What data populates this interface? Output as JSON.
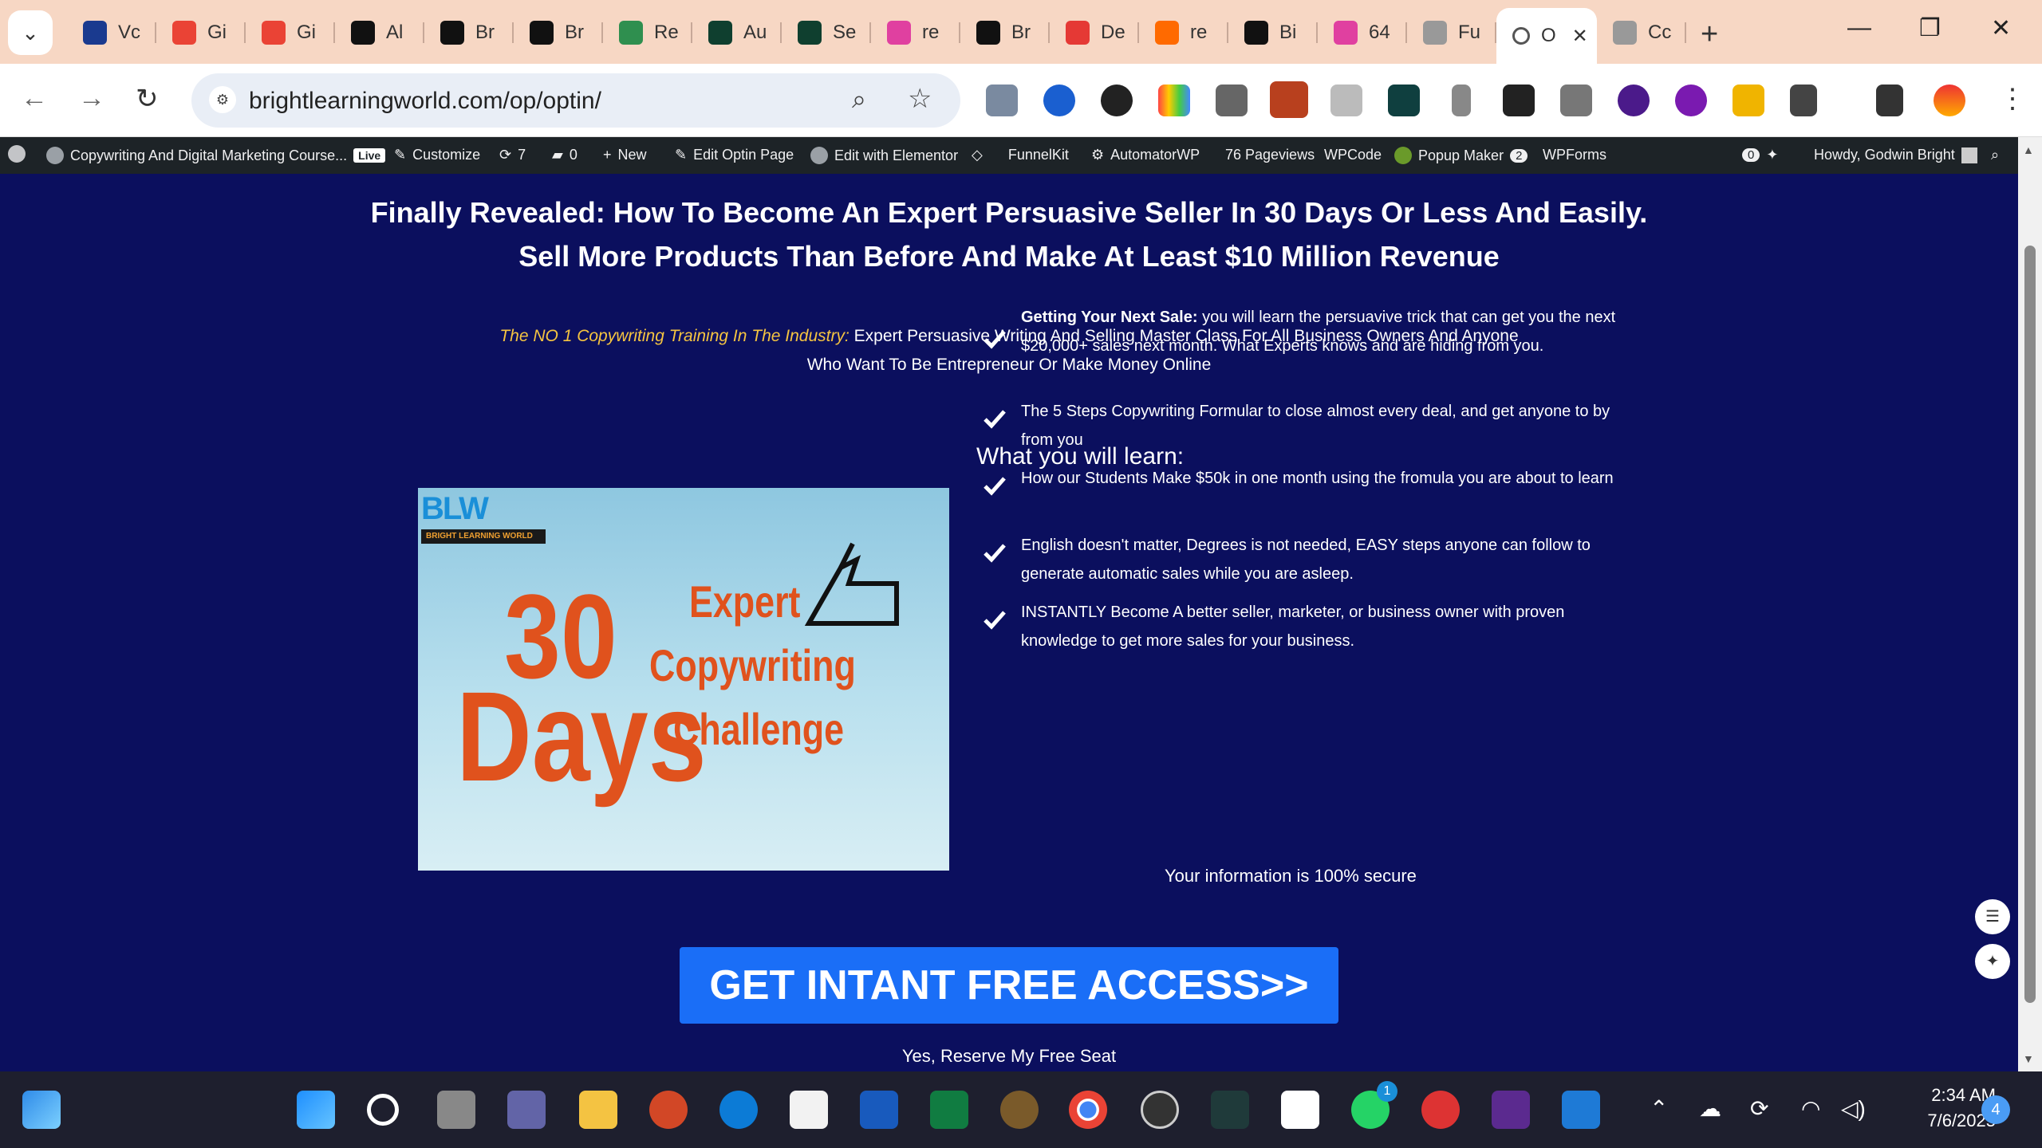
{
  "browser": {
    "tabs": [
      {
        "label": "Vc",
        "color": "#1a3a8f"
      },
      {
        "label": "Gi",
        "color": "#ea4335"
      },
      {
        "label": "Gi",
        "color": "#ea4335"
      },
      {
        "label": "Al",
        "color": "#111111"
      },
      {
        "label": "Br",
        "color": "#111111"
      },
      {
        "label": "Br",
        "color": "#111111"
      },
      {
        "label": "Re",
        "color": "#2f8f4f"
      },
      {
        "label": "Au",
        "color": "#0f3f2f"
      },
      {
        "label": "Se",
        "color": "#0f3f2f"
      },
      {
        "label": "re",
        "color": "#e040a0"
      },
      {
        "label": "Br",
        "color": "#111111"
      },
      {
        "label": "De",
        "color": "#e53935"
      },
      {
        "label": "re",
        "color": "#ff6a00"
      },
      {
        "label": "Bi",
        "color": "#111111"
      },
      {
        "label": "64",
        "color": "#e040a0"
      },
      {
        "label": "Fu",
        "color": "#999999"
      },
      {
        "label": "O",
        "color": "#ffffff",
        "active": true
      },
      {
        "label": "Cc",
        "color": "#999999"
      }
    ],
    "new_tab": "+",
    "window_controls": {
      "minimize": "—",
      "restore": "❐",
      "close": "✕"
    },
    "url": "brightlearningworld.com/op/optin/",
    "nav": {
      "back": "←",
      "forward": "→",
      "reload": "↻"
    }
  },
  "adminbar": {
    "site_name": "Copywriting And Digital Marketing Course...",
    "live": "Live",
    "customize": "Customize",
    "updates": "7",
    "comments": "0",
    "new": "New",
    "edit_optin": "Edit Optin Page",
    "edit_elementor": "Edit with Elementor",
    "funnelkit": "FunnelKit",
    "automatorwp": "AutomatorWP",
    "pageviews": "76 Pageviews",
    "wpcode": "WPCode",
    "popup_maker": "Popup Maker",
    "popup_count": "2",
    "wpforms": "WPForms",
    "notif_count": "0",
    "howdy": "Howdy, Godwin Bright"
  },
  "page": {
    "headline_1": "Finally Revealed: How To Become An Expert Persuasive Seller In 30 Days Or Less And Easily.",
    "headline_2": "Sell More Products Than Before And Make At Least $10 Million Revenue",
    "sub_accent": "The NO 1 Copywriting Training In The Industry:",
    "sub_1": " Expert Persuasive Writing And Selling Master Class For All Business Owners And Anyone",
    "sub_2": "Who Want To Be Entrepreneur Or Make Money Online",
    "hero": {
      "logo_text": "BLW",
      "logo_caption": "BRIGHT LEARNING WORLD",
      "num": "30",
      "days": "Days",
      "line1": "Expert",
      "line2": "Copywriting",
      "line3": "Challenge"
    },
    "learn_title": "What you will learn:",
    "learn_items": [
      {
        "bold": "Getting Your Next Sale:",
        "text": " you will learn the persuavive trick that can get you the next $20,000+ sales next month. What Experts knows and are hiding from you."
      },
      {
        "bold": "",
        "text": "The 5 Steps Copywriting Formular to close almost every deal, and get anyone to by from you"
      },
      {
        "bold": "",
        "text": "How our Students Make $50k in one month using the fromula you are about to learn"
      },
      {
        "bold": "",
        "text": "English doesn't matter, Degrees is not needed, EASY steps anyone can follow to generate automatic sales while you are asleep."
      },
      {
        "bold": "",
        "text": "INSTANTLY Become A better seller, marketer, or business owner with proven knowledge to get more sales for your business."
      }
    ],
    "secure": "Your information is 100% secure",
    "cta": "GET INTANT FREE ACCESS>>",
    "reserve": "Yes, Reserve My Free Seat"
  },
  "taskbar": {
    "time": "2:34 AM",
    "date": "7/6/2025",
    "notifications": "4",
    "whatsapp_badge": "1"
  }
}
